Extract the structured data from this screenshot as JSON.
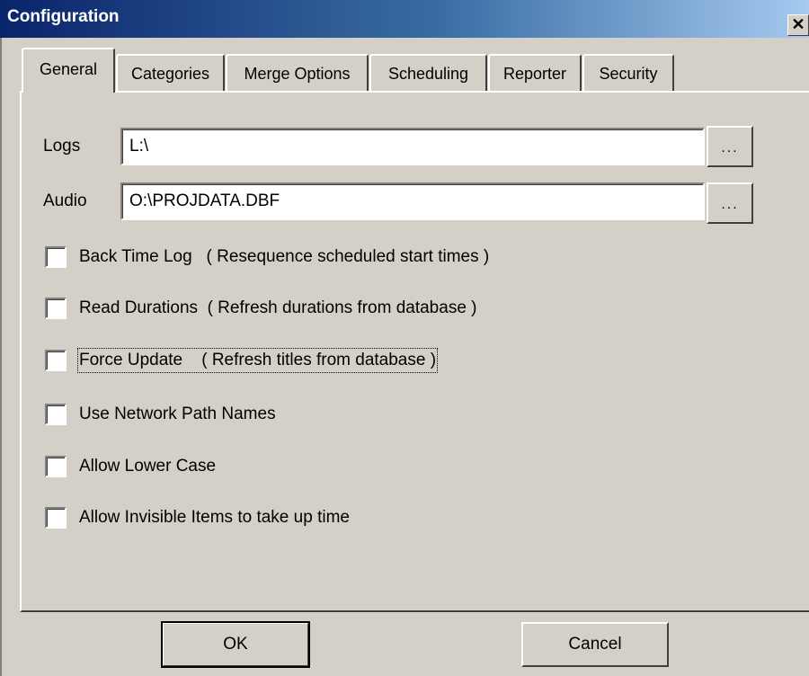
{
  "window": {
    "title": "Configuration",
    "close_symbol": "✕"
  },
  "tabs": [
    {
      "label": "General",
      "active": true
    },
    {
      "label": "Categories"
    },
    {
      "label": "Merge Options"
    },
    {
      "label": "Scheduling"
    },
    {
      "label": "Reporter"
    },
    {
      "label": "Security"
    }
  ],
  "fields": {
    "logs": {
      "label": "Logs",
      "value": "L:\\",
      "browse_label": "..."
    },
    "audio": {
      "label": "Audio",
      "value": "O:\\PROJDATA.DBF",
      "browse_label": "..."
    }
  },
  "options": [
    {
      "label": "Back Time Log   ( Resequence scheduled start times )",
      "checked": false
    },
    {
      "label": "Read Durations  ( Refresh durations from database )",
      "checked": false
    },
    {
      "label": "Force Update    ( Refresh titles from database )",
      "checked": false,
      "focused": true
    },
    {
      "label": "Use Network Path Names",
      "checked": false
    },
    {
      "label": "Allow Lower Case",
      "checked": false
    },
    {
      "label": "Allow Invisible Items to take up time",
      "checked": false
    }
  ],
  "buttons": {
    "ok": "OK",
    "cancel": "Cancel"
  }
}
